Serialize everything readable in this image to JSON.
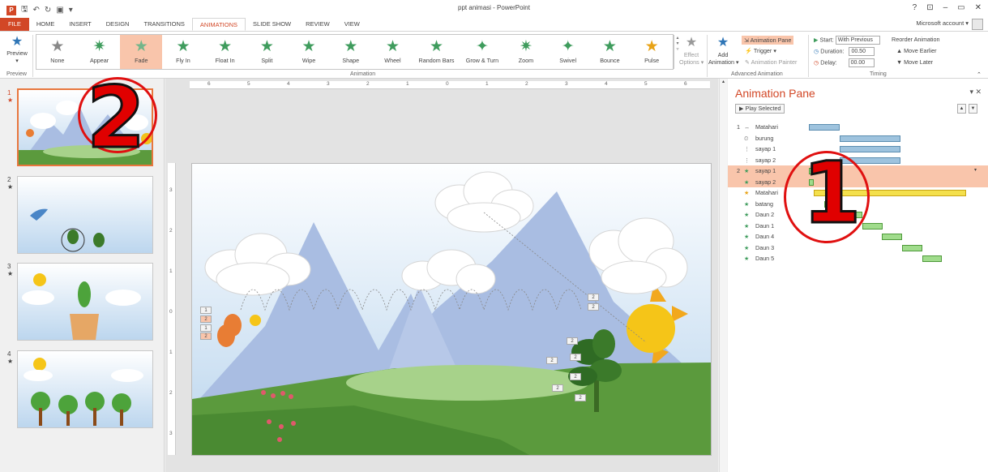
{
  "window": {
    "title": "ppt animasi - PowerPoint",
    "account": "Microsoft account ▾",
    "controls": [
      "?",
      "⊡",
      "–",
      "▭",
      "✕"
    ]
  },
  "qat": {
    "icons": [
      "save-icon",
      "undo-icon",
      "redo-icon",
      "start-from-beginning-icon"
    ]
  },
  "tabs": [
    {
      "label": "FILE"
    },
    {
      "label": "HOME"
    },
    {
      "label": "INSERT"
    },
    {
      "label": "DESIGN"
    },
    {
      "label": "TRANSITIONS"
    },
    {
      "label": "ANIMATIONS"
    },
    {
      "label": "SLIDE SHOW"
    },
    {
      "label": "REVIEW"
    },
    {
      "label": "VIEW"
    }
  ],
  "active_tab": "ANIMATIONS",
  "ribbon": {
    "preview": {
      "label": "Preview",
      "sub": "▾",
      "group": "Preview"
    },
    "group_animation": "Animation",
    "effects": [
      {
        "label": "None",
        "icon": "★",
        "color": "#888888"
      },
      {
        "label": "Appear",
        "icon": "✷",
        "color": "#3f9c5d"
      },
      {
        "label": "Fade",
        "icon": "★",
        "color": "#73b58a"
      },
      {
        "label": "Fly In",
        "icon": "★",
        "color": "#3f9c5d"
      },
      {
        "label": "Float In",
        "icon": "★",
        "color": "#3f9c5d"
      },
      {
        "label": "Split",
        "icon": "★",
        "color": "#3f9c5d"
      },
      {
        "label": "Wipe",
        "icon": "★",
        "color": "#3f9c5d"
      },
      {
        "label": "Shape",
        "icon": "★",
        "color": "#3f9c5d"
      },
      {
        "label": "Wheel",
        "icon": "★",
        "color": "#3f9c5d"
      },
      {
        "label": "Random Bars",
        "icon": "★",
        "color": "#3f9c5d"
      },
      {
        "label": "Grow & Turn",
        "icon": "✦",
        "color": "#3f9c5d"
      },
      {
        "label": "Zoom",
        "icon": "✷",
        "color": "#3f9c5d"
      },
      {
        "label": "Swivel",
        "icon": "✦",
        "color": "#3f9c5d"
      },
      {
        "label": "Bounce",
        "icon": "★",
        "color": "#3f9c5d"
      },
      {
        "label": "Pulse",
        "icon": "★",
        "color": "#e8a317"
      }
    ],
    "selected_effect": "Fade",
    "effect_options": {
      "label": "Effect",
      "label2": "Options ▾"
    },
    "add_animation": {
      "label": "Add",
      "label2": "Animation ▾"
    },
    "animation_pane_btn": "Animation Pane",
    "trigger_btn": "Trigger ▾",
    "animation_painter_btn": "Animation Painter",
    "group_advanced": "Advanced Animation",
    "start_label": "Start:",
    "start_value": "With Previous",
    "duration_label": "Duration:",
    "duration_value": "00.50",
    "delay_label": "Delay:",
    "delay_value": "00.00",
    "reorder_title": "Reorder Animation",
    "move_earlier": "Move Earlier",
    "move_later": "Move Later",
    "group_timing": "Timing"
  },
  "slides": [
    {
      "num": "1",
      "mark": "★"
    },
    {
      "num": "2",
      "mark": "★"
    },
    {
      "num": "3",
      "mark": "★"
    },
    {
      "num": "4",
      "mark": "★"
    }
  ],
  "ruler": {
    "h_ticks": [
      "6",
      "5",
      "4",
      "3",
      "2",
      "1",
      "0",
      "1",
      "2",
      "3",
      "4",
      "5",
      "6"
    ],
    "v_ticks": [
      "3",
      "2",
      "1",
      "0",
      "1",
      "2",
      "3"
    ]
  },
  "slide_tags": [
    "1",
    "2",
    "1",
    "2",
    "2",
    "2",
    "2",
    "2",
    "2",
    "2",
    "2",
    "2"
  ],
  "animation_pane": {
    "title": "Animation Pane",
    "close": "▾ ✕",
    "play_selected": "▶  Play Selected",
    "items": [
      {
        "num": "1",
        "icon": "↔",
        "icon_kind": "motion",
        "label": "Matahari",
        "bar": "blue",
        "start": 0,
        "dur": 0.5
      },
      {
        "num": "",
        "icon": "⏲",
        "icon_kind": "clock",
        "label": "burung",
        "bar": "blue",
        "start": 0.5,
        "dur": 1.0
      },
      {
        "num": "",
        "icon": "⋮",
        "icon_kind": "motion",
        "label": "sayap 1",
        "bar": "blue",
        "start": 0.5,
        "dur": 1.0
      },
      {
        "num": "",
        "icon": "⋮",
        "icon_kind": "motion",
        "label": "sayap 2",
        "bar": "blue",
        "start": 0.5,
        "dur": 1.0
      },
      {
        "num": "2",
        "icon": "★",
        "icon_kind": "star",
        "label": "sayap 1",
        "bar": "green",
        "start": 0,
        "dur": 0.08,
        "selected": true
      },
      {
        "num": "",
        "icon": "★",
        "icon_kind": "star",
        "label": "sayap 2",
        "bar": "green",
        "start": 0,
        "dur": 0.08,
        "selected": true
      },
      {
        "num": "",
        "icon": "★",
        "icon_kind": "gold",
        "label": "Matahari",
        "bar": "yellow",
        "start": 0.08,
        "dur": 2.5
      },
      {
        "num": "",
        "icon": "★",
        "icon_kind": "star",
        "label": "batang",
        "bar": "green",
        "start": 0.25,
        "dur": 0.3
      },
      {
        "num": "",
        "icon": "★",
        "icon_kind": "star",
        "label": "Daun 2",
        "bar": "green",
        "start": 0.55,
        "dur": 0.33
      },
      {
        "num": "",
        "icon": "★",
        "icon_kind": "star",
        "label": "Daun 1",
        "bar": "green",
        "start": 0.88,
        "dur": 0.33
      },
      {
        "num": "",
        "icon": "★",
        "icon_kind": "star",
        "label": "Daun 4",
        "bar": "green",
        "start": 1.2,
        "dur": 0.33
      },
      {
        "num": "",
        "icon": "★",
        "icon_kind": "star",
        "label": "Daun 3",
        "bar": "green",
        "start": 1.53,
        "dur": 0.33
      },
      {
        "num": "",
        "icon": "★",
        "icon_kind": "star",
        "label": "Daun 5",
        "bar": "green",
        "start": 1.86,
        "dur": 0.33
      }
    ]
  },
  "overlay_numbers": [
    "2",
    "1"
  ],
  "colors": {
    "accent": "#d24726",
    "selection": "#f9c5ab",
    "overlay_red": "#e00000"
  }
}
